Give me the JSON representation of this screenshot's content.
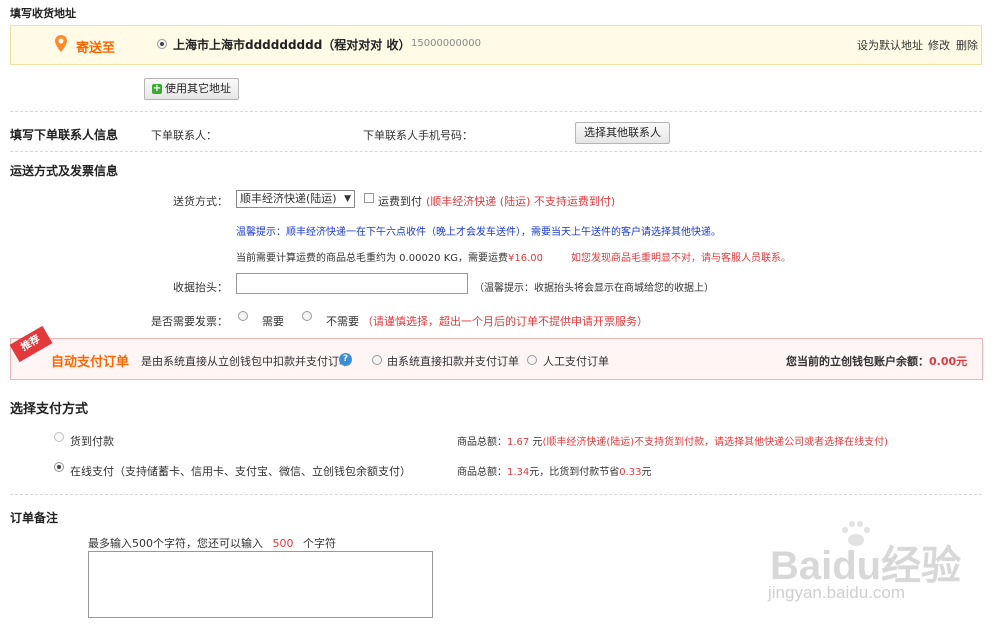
{
  "address": {
    "section_title": "填写收货地址",
    "send_to_label": "寄送至",
    "address_text": "上海市上海市ddddddddd（程对对对  收）",
    "phone": "15000000000",
    "set_default": "设为默认地址",
    "edit": "修改",
    "delete": "删除",
    "use_other_button": "使用其它地址"
  },
  "contact": {
    "section_title": "填写下单联系人信息",
    "name_label": "下单联系人：",
    "phone_label": "下单联系人手机号码：",
    "choose_button": "选择其他联系人"
  },
  "delivery": {
    "section_title": "运送方式及发票信息",
    "method_label": "送货方式：",
    "method_selected": "顺丰经济快递(陆运)",
    "cod_freight_label": "运费到付",
    "cod_freight_note": "(顺丰经济快递 (陆运) 不支持运费到付)",
    "tip": "温馨提示：顺丰经济快递一在下午六点收件（晚上才会发车送件），需要当天上午送件的客户请选择其他快递。",
    "weight_text": "当前需要计算运费的商品总毛重约为 0.00020 KG，需要运费",
    "freight_amount": "¥16.00",
    "weight_warning": "如您发现商品毛重明显不对，请与客服人员联系。",
    "receipt_label": "收据抬头：",
    "receipt_value": "",
    "receipt_tip": "（温馨提示：收据抬头将会显示在商城给您的收据上）",
    "invoice_label": "是否需要发票：",
    "invoice_yes": "需要",
    "invoice_no": "不需要",
    "invoice_note": "（请谨慎选择，超出一个月后的订单不提供申请开票服务）"
  },
  "autopay": {
    "badge": "推荐",
    "title": "自动支付订单",
    "question": "是由系统直接从立创钱包中扣款并支付订单",
    "help_icon": "?",
    "option_auto": "由系统直接扣款并支付订单",
    "option_manual": "人工支付订单",
    "balance_label": "您当前的立创钱包账户余额：",
    "balance_value": "0.00元"
  },
  "payment": {
    "section_title": "选择支付方式",
    "cod_label": "货到付款",
    "cod_total_label": "商品总额：",
    "cod_total_value": "1.67",
    "cod_total_unit": "元",
    "cod_note": "(顺丰经济快递(陆运)不支持货到付款，请选择其他快递公司或者选择在线支付)",
    "online_label": "在线支付（支持储蓄卡、信用卡、支付宝、微信、立创钱包余额支付）",
    "online_total_label": "商品总额：",
    "online_total_value": "1.34",
    "online_total_mid": "元，比货到付款节省",
    "online_saving": "0.33",
    "online_saving_unit": "元"
  },
  "remark": {
    "section_title": "订单备注",
    "hint_prefix": "最多输入500个字符，您还可以输入",
    "remaining": "500",
    "hint_suffix": "个字符",
    "value": ""
  },
  "watermark": {
    "main": "Baidu经验",
    "url": "jingyan.baidu.com"
  },
  "colors": {
    "accent_red": "#e4393c",
    "autopay_title": "#ff6600",
    "highlight_bg": "#fffbe6",
    "blue_tip": "#1a3bd1"
  }
}
